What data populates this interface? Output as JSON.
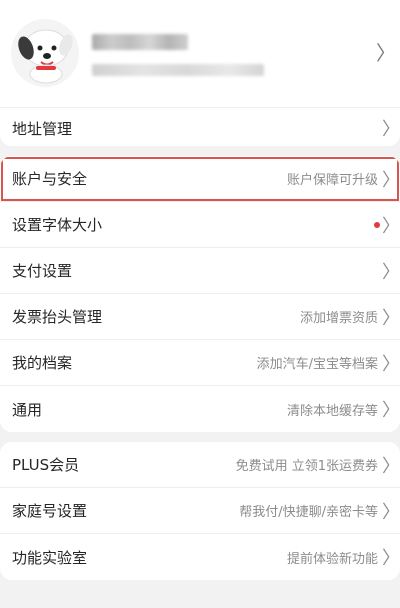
{
  "profile": {
    "chevron": "〉"
  },
  "address": {
    "label": "地址管理",
    "arrow": "〉"
  },
  "settings": [
    {
      "label": "账户与安全",
      "value": "账户保障可升级",
      "arrow": "〉"
    },
    {
      "label": "设置字体大小",
      "value": "",
      "arrow": "〉",
      "badge": "red-dot"
    },
    {
      "label": "支付设置",
      "value": "",
      "arrow": "〉"
    },
    {
      "label": "发票抬头管理",
      "value": "添加增票资质",
      "arrow": "〉"
    },
    {
      "label": "我的档案",
      "value": "添加汽车/宝宝等档案",
      "arrow": "〉"
    },
    {
      "label": "通用",
      "value": "清除本地缓存等",
      "arrow": "〉"
    }
  ],
  "extras": [
    {
      "label": "PLUS会员",
      "value": "免费试用 立领1张运费券",
      "arrow": "〉"
    },
    {
      "label": "家庭号设置",
      "value": "帮我付/快捷聊/亲密卡等",
      "arrow": "〉"
    },
    {
      "label": "功能实验室",
      "value": "提前体验新功能",
      "arrow": "〉"
    }
  ],
  "colors": {
    "accent_red": "#e4393c",
    "highlight_border": "#d9534f",
    "background": "#f2f2f2"
  },
  "icons": {
    "avatar": "jd-dog-mascot-avatar",
    "chevron": "chevron-right-icon"
  }
}
